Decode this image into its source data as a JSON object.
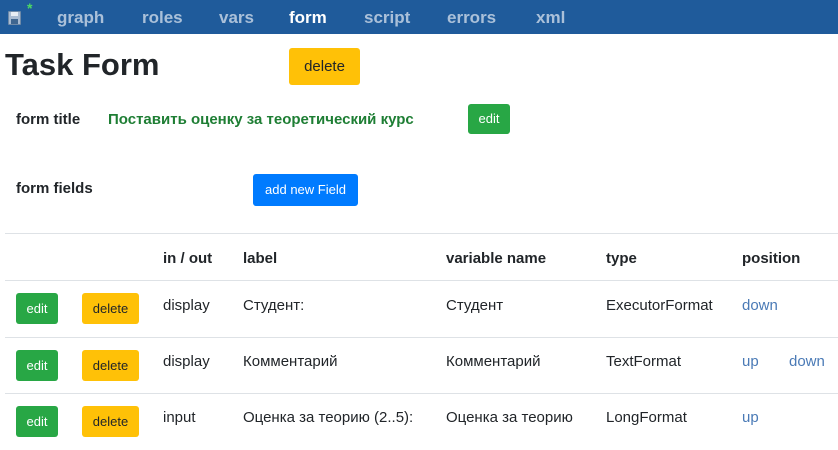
{
  "nav": {
    "items": [
      {
        "label": "graph"
      },
      {
        "label": "roles"
      },
      {
        "label": "vars"
      },
      {
        "label": "form",
        "active": true
      },
      {
        "label": "script"
      },
      {
        "label": "errors"
      },
      {
        "label": "xml"
      }
    ],
    "save_icon": "floppy-disk-icon",
    "modified_mark": "*"
  },
  "page": {
    "title": "Task Form",
    "delete_label": "delete"
  },
  "form_title": {
    "label": "form title",
    "value": "Поставить оценку за теоретический курс",
    "edit_label": "edit"
  },
  "form_fields": {
    "label": "form fields",
    "add_label": "add new Field"
  },
  "table": {
    "headers": [
      "in / out",
      "label",
      "variable name",
      "type",
      "position"
    ],
    "rows": [
      {
        "edit": "edit",
        "delete": "delete",
        "inout": "display",
        "label": "Студент:",
        "variable": "Студент",
        "type": "ExecutorFormat",
        "up": "",
        "down": "down"
      },
      {
        "edit": "edit",
        "delete": "delete",
        "inout": "display",
        "label": "Комментарий",
        "variable": "Комментарий",
        "type": "TextFormat",
        "up": "up",
        "down": "down"
      },
      {
        "edit": "edit",
        "delete": "delete",
        "inout": "input",
        "label": "Оценка за теорию (2..5):",
        "variable": "Оценка за теорию",
        "type": "LongFormat",
        "up": "up",
        "down": ""
      }
    ]
  },
  "colors": {
    "nav_bg": "#1f5b9b",
    "warning": "#ffc107",
    "success": "#28a745",
    "primary": "#007bff",
    "title_green": "#1e7e34",
    "link": "#4a7ab6"
  }
}
